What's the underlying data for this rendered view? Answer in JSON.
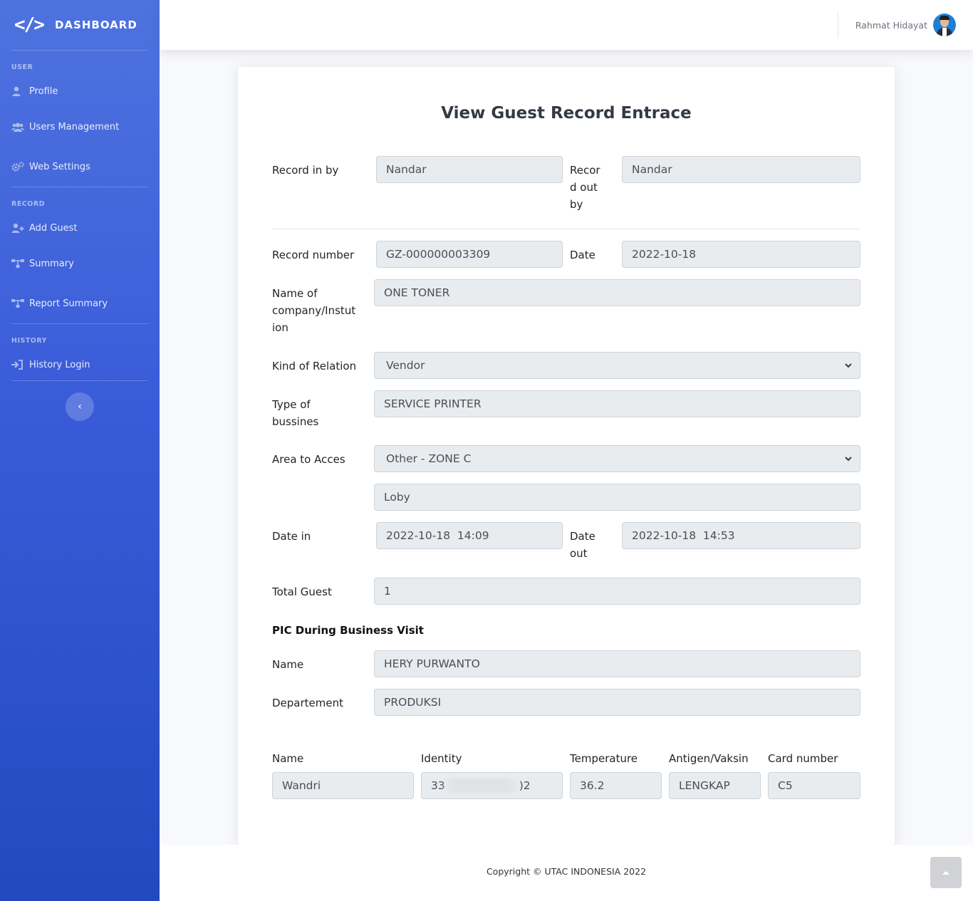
{
  "sidebar": {
    "brand": "DASHBOARD",
    "brand_icon": "</>",
    "toggle_icon": "‹",
    "sections": [
      {
        "heading": "USER",
        "items": [
          {
            "label": "Profile",
            "icon": "user-icon"
          },
          {
            "label": "Users Management",
            "icon": "users-icon"
          },
          {
            "label": "Web Settings",
            "icon": "cogs-icon"
          }
        ]
      },
      {
        "heading": "RECORD",
        "items": [
          {
            "label": "Add Guest",
            "icon": "user-plus-icon"
          },
          {
            "label": "Summary",
            "icon": "sitemap-icon"
          },
          {
            "label": "Report Summary",
            "icon": "sitemap-icon"
          }
        ]
      },
      {
        "heading": "HISTORY",
        "items": [
          {
            "label": "History Login",
            "icon": "sign-in-icon"
          }
        ]
      }
    ]
  },
  "topbar": {
    "user_name": "Rahmat Hidayat"
  },
  "form": {
    "title": "View Guest Record Entrace",
    "record_in_by": {
      "label": "Record in by",
      "value": "Nandar"
    },
    "record_out_by": {
      "label": "Recor\nd out\nby",
      "value": "Nandar"
    },
    "record_number": {
      "label": "Record number",
      "value": "GZ-000000003309"
    },
    "date": {
      "label": "Date",
      "value": "2022-10-18"
    },
    "company": {
      "label": "Name of\ncompany/Instut\nion",
      "value": "ONE TONER"
    },
    "relation": {
      "label": "Kind of Relation",
      "value": "Vendor"
    },
    "business": {
      "label": "Type of\nbussines",
      "value": "SERVICE PRINTER"
    },
    "area": {
      "label": "Area to Acces",
      "value": "Other - ZONE C",
      "detail": "Loby"
    },
    "date_in": {
      "label": "Date in",
      "value": "2022-10-18  14:09"
    },
    "date_out": {
      "label": "Date\nout",
      "value": "2022-10-18  14:53"
    },
    "total_guest": {
      "label": "Total Guest",
      "value": "1"
    },
    "pic": {
      "heading": "PIC During Business Visit",
      "name_label": "Name",
      "name_value": "HERY PURWANTO",
      "dept_label": "Departement",
      "dept_value": "PRODUKSI"
    },
    "guest_table": {
      "headers": [
        "Name",
        "Identity",
        "Temperature",
        "Antigen/Vaksin",
        "Card number"
      ],
      "row": {
        "name": "Wandri",
        "identity_start": "33",
        "identity_end": ")2",
        "temperature": "36.2",
        "antigen": "LENGKAP",
        "card": "C5"
      }
    }
  },
  "footer": {
    "copyright": "Copyright © UTAC INDONESIA 2022"
  }
}
